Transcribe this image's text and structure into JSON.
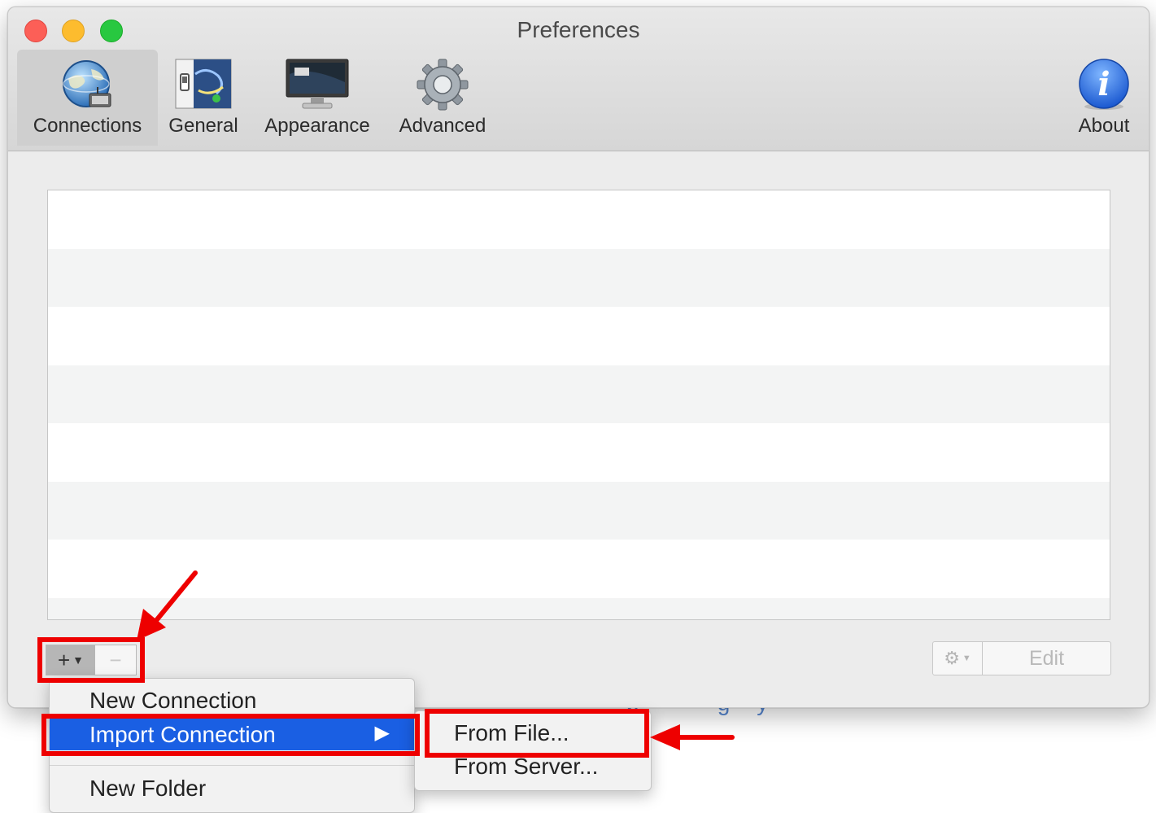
{
  "window": {
    "title": "Preferences"
  },
  "toolbar": {
    "items": [
      {
        "label": "Connections",
        "icon": "globe-network-icon",
        "selected": true
      },
      {
        "label": "General",
        "icon": "switch-panel-icon",
        "selected": false
      },
      {
        "label": "Appearance",
        "icon": "monitor-icon",
        "selected": false
      },
      {
        "label": "Advanced",
        "icon": "gear-icon",
        "selected": false
      }
    ],
    "about": {
      "label": "About",
      "icon": "info-icon"
    }
  },
  "connections_list": {
    "rows": 8
  },
  "buttons": {
    "add": "+",
    "remove": "−",
    "edit": "Edit"
  },
  "add_menu": {
    "items": [
      {
        "label": "New Connection",
        "highlighted": false
      },
      {
        "label": "Import Connection",
        "highlighted": true,
        "submenu_arrow": "▶"
      },
      {
        "label": "New Folder",
        "highlighted": false
      }
    ],
    "submenu": {
      "items": [
        {
          "label": "From File...",
          "annotated": true
        },
        {
          "label": "From Server..."
        }
      ]
    }
  },
  "colors": {
    "highlight": "#1a5fe3",
    "annotation": "#ee0000",
    "about_icon": "#2a6fe0"
  }
}
